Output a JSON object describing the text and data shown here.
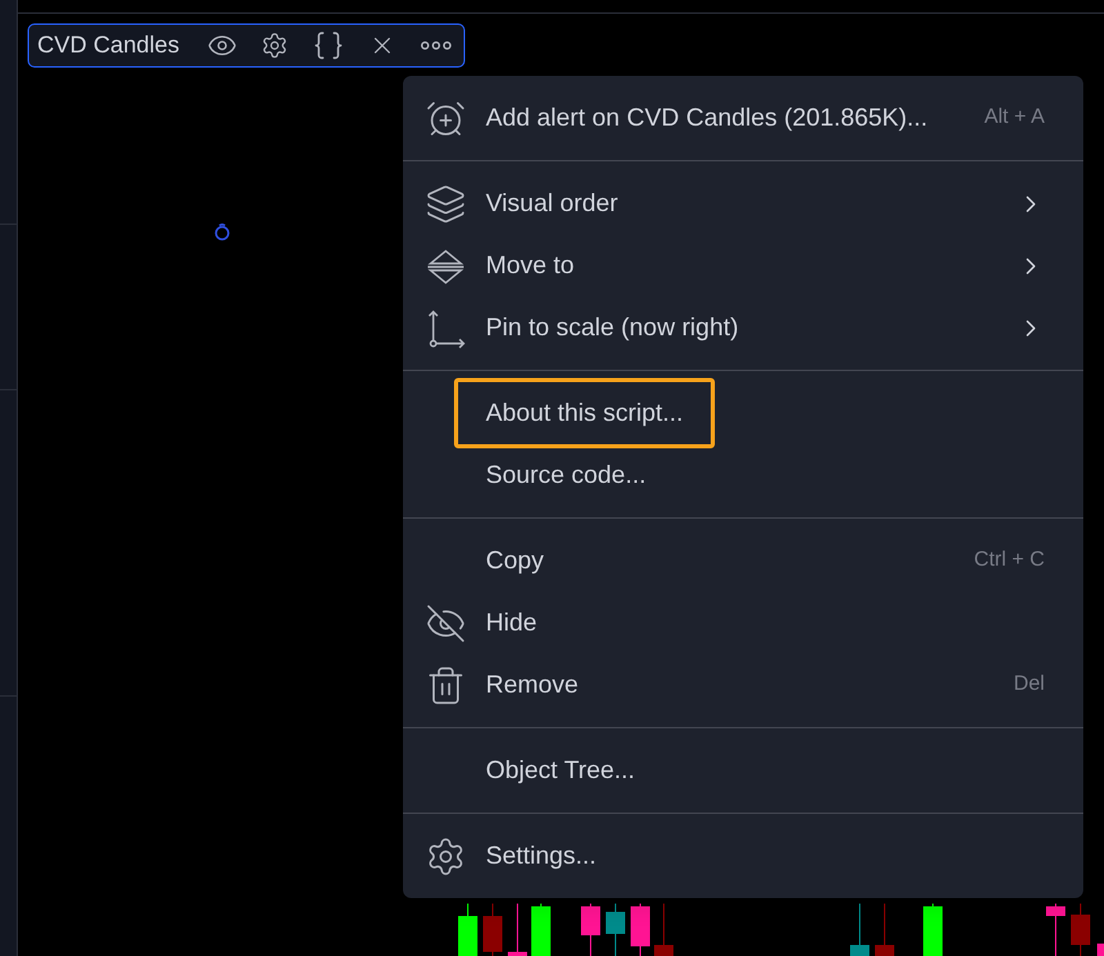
{
  "legend": {
    "title": "CVD Candles",
    "selected": true
  },
  "menu": {
    "groups": [
      [
        {
          "label": "Add alert on CVD Candles (201.865K)...",
          "shortcut": "Alt + A",
          "submenu": false,
          "highlighted": false
        }
      ],
      [
        {
          "label": "Visual order",
          "submenu": true,
          "highlighted": false
        },
        {
          "label": "Move to",
          "submenu": true,
          "highlighted": false
        },
        {
          "label": "Pin to scale (now right)",
          "submenu": true,
          "highlighted": false
        }
      ],
      [
        {
          "label": "About this script...",
          "submenu": false,
          "highlighted": true
        },
        {
          "label": "Source code...",
          "submenu": false,
          "highlighted": false
        }
      ],
      [
        {
          "label": "Copy",
          "shortcut": "Ctrl + C",
          "submenu": false,
          "highlighted": false
        },
        {
          "label": "Hide",
          "submenu": false,
          "highlighted": false
        },
        {
          "label": "Remove",
          "shortcut": "Del",
          "submenu": false,
          "highlighted": false
        }
      ],
      [
        {
          "label": "Object Tree...",
          "submenu": false,
          "highlighted": false
        }
      ],
      [
        {
          "label": "Settings...",
          "submenu": false,
          "highlighted": false
        }
      ]
    ]
  }
}
